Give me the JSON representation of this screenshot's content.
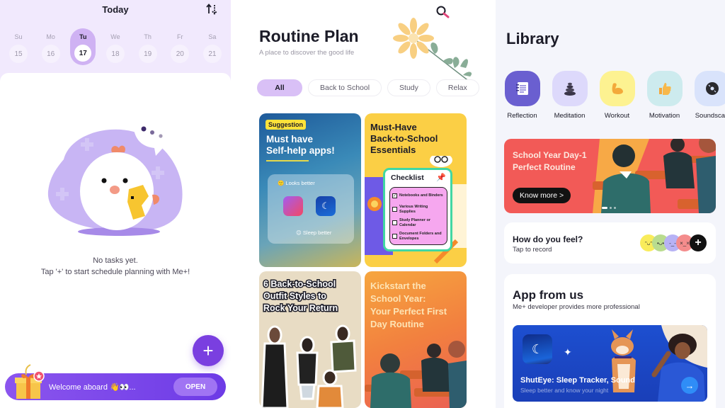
{
  "today_panel": {
    "title": "Today",
    "sort_icon": "sort-arrows-icon",
    "week": [
      {
        "day": "Su",
        "date": "15",
        "active": false
      },
      {
        "day": "Mo",
        "date": "16",
        "active": false
      },
      {
        "day": "Tu",
        "date": "17",
        "active": true
      },
      {
        "day": "We",
        "date": "18",
        "active": false
      },
      {
        "day": "Th",
        "date": "19",
        "active": false
      },
      {
        "day": "Fr",
        "date": "20",
        "active": false
      },
      {
        "day": "Sa",
        "date": "21",
        "active": false
      }
    ],
    "empty_line1": "No tasks yet.",
    "empty_line2": "Tap '+' to start schedule planning with Me+!",
    "fab_label": "+",
    "welcome": {
      "text": "Welcome aboard 👋👀...",
      "button": "OPEN"
    }
  },
  "routine_panel": {
    "title": "Routine Plan",
    "subtitle": "A place to discover the good life",
    "filters": [
      "All",
      "Back to School",
      "Study",
      "Relax"
    ],
    "active_filter": "All",
    "tiles": {
      "t1": {
        "badge": "Suggestion",
        "title_line1": "Must have",
        "title_line2": "Self-help apps!",
        "label1": "🙂 Looks better",
        "label2": "😌 Sleep better"
      },
      "t2": {
        "title_line1": "Must-Have",
        "title_line2": "Back-to-School",
        "title_line3": "Essentials",
        "checklist_title": "Checklist",
        "items": [
          {
            "text": "Notebooks and Binders",
            "checked": true
          },
          {
            "text": "Various Writing Supplies",
            "checked": false
          },
          {
            "text": "Study Planner or Calendar",
            "checked": false
          },
          {
            "text": "Document Folders and Envelopes",
            "checked": false
          }
        ]
      },
      "t3": {
        "title_line1": "6 Back-to-School",
        "title_line2": "Outfit Styles to",
        "title_line3": "Rock Your Return"
      },
      "t4": {
        "title_line1": "Kickstart the",
        "title_line2": "School Year:",
        "title_line3": "Your Perfect First",
        "title_line4": "Day Routine"
      }
    }
  },
  "library_panel": {
    "title": "Library",
    "categories": [
      {
        "label": "Reflection",
        "icon": "notebook-icon",
        "color": "#6a5fd0"
      },
      {
        "label": "Meditation",
        "icon": "stacked-stones-icon",
        "color": "#ddd9fb"
      },
      {
        "label": "Workout",
        "icon": "flexed-bicep-icon",
        "color": "#fdf291"
      },
      {
        "label": "Motivation",
        "icon": "thumbs-up-icon",
        "color": "#cdebee"
      },
      {
        "label": "Soundscap",
        "icon": "vinyl-disc-icon",
        "color": "#d9e3fb"
      }
    ],
    "banner": {
      "title_line1": "School Year Day-1",
      "title_line2": "Perfect Routine",
      "button": "Know more >",
      "slides": 3,
      "active_slide": 1
    },
    "feel": {
      "title": "How do you feel?",
      "subtitle": "Tap to record",
      "moods": [
        {
          "name": "happy",
          "color": "#f9ec5b",
          "face": "ᵔᴗᵔ"
        },
        {
          "name": "calm",
          "color": "#b9dc8f",
          "face": "•ᴗ•"
        },
        {
          "name": "meh",
          "color": "#b7b2f5",
          "face": "-_-"
        },
        {
          "name": "angry",
          "color": "#f48c8c",
          "face": "×_×"
        }
      ],
      "add_label": "+"
    },
    "app_from_us": {
      "title": "App from us",
      "subtitle": "Me+ developer provides more professional",
      "app_title": "ShutEye: Sleep Tracker, Sound",
      "app_subtitle": "Sleep better and know your night",
      "arrow": "→"
    }
  }
}
